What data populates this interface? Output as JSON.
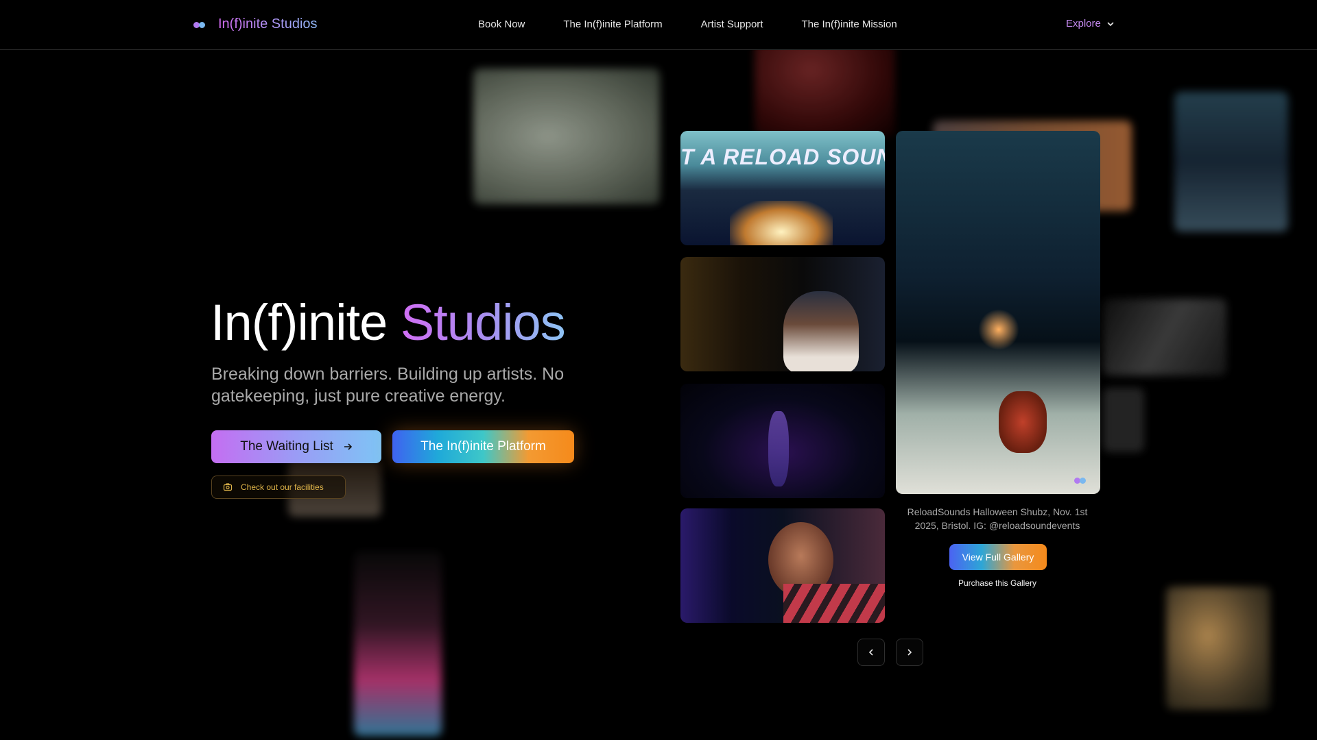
{
  "nav": {
    "brand": "In(f)inite Studios",
    "links": [
      "Book Now",
      "The In(f)inite Platform",
      "Artist Support",
      "The In(f)inite Mission"
    ],
    "explore": "Explore",
    "explore_icon": "chevron-down-icon"
  },
  "hero": {
    "title_plain": "In(f)inite",
    "title_accent": "Studios",
    "subtitle": "Breaking down barriers. Building up artists. No gatekeeping, just pure creative energy.",
    "waiting_list_label": "The Waiting List",
    "waiting_list_icon": "arrow-right-icon",
    "platform_label": "The In(f)inite Platform",
    "facilities_label": "Check out our facilities",
    "facilities_icon": "camera-icon"
  },
  "gallery": {
    "caption": "ReloadSounds Halloween Shubz, Nov. 1st 2025, Bristol. IG: @reloadsoundevents",
    "view_full_label": "View Full Gallery",
    "purchase_label": "Purchase this Gallery",
    "sign_text": "T A RELOAD SOUN",
    "prev_icon": "chevron-left-icon",
    "next_icon": "chevron-right-icon"
  },
  "colors": {
    "accent_purple": "#c46ef2",
    "accent_blue": "#7ec4f5",
    "accent_orange": "#f58a1b",
    "facilities_gold": "#e0b54a"
  }
}
